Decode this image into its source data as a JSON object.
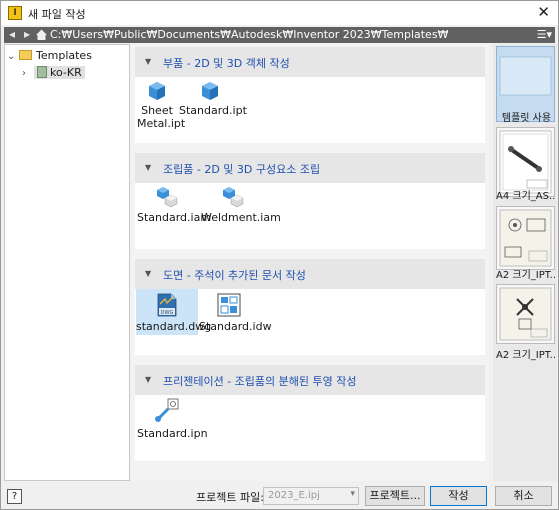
{
  "window": {
    "title": "새 파일 작성",
    "close_glyph": "✕",
    "app_icon_letter": "I"
  },
  "pathbar": {
    "back_glyph": "◂",
    "forward_glyph": "▸",
    "path": "C:₩Users₩Public₩Documents₩Autodesk₩Inventor 2023₩Templates₩",
    "view_glyph": "☰▾"
  },
  "tree": {
    "root": {
      "expand_glyph": "⌄",
      "label": "Templates"
    },
    "child": {
      "expand_glyph": "›",
      "label": "ko-KR"
    }
  },
  "sections": [
    {
      "arrow": "▼",
      "title": "부품 - 2D 및 3D 객체 작성",
      "files": [
        {
          "name": "Sheet\nMetal.ipt"
        },
        {
          "name": "Standard.ipt"
        }
      ]
    },
    {
      "arrow": "▼",
      "title": "조립품 - 2D 및 3D 구성요소 조립",
      "files": [
        {
          "name": "Standard.iam"
        },
        {
          "name": "Weldment.iam"
        }
      ]
    },
    {
      "arrow": "▼",
      "title": "도면 - 주석이 추가된 문서 작성",
      "files": [
        {
          "name": "standard.dwg",
          "badge": "DWG"
        },
        {
          "name": "Standard.idw"
        }
      ]
    },
    {
      "arrow": "▼",
      "title": "프리젠테이션 - 조립품의 분해된 투영 작성",
      "files": [
        {
          "name": "Standard.ipn"
        }
      ]
    }
  ],
  "sidebar": {
    "items": [
      {
        "label": "템플릿 사용"
      },
      {
        "label": "A4 크기_AS..."
      },
      {
        "label": "A2 크기_IPT..."
      },
      {
        "label": "A2 크기_IPT..."
      }
    ]
  },
  "footer": {
    "help_glyph": "?",
    "project_label": "프로젝트 파일:",
    "project_value": "2023_E.ipj",
    "project_dropdown_glyph": "▾",
    "projects_button": "프로젝트...",
    "create_button": "작성",
    "cancel_button": "취소"
  },
  "colors": {
    "accent": "#1f4fae",
    "selection": "#cce4f7",
    "pathbar": "#616161"
  }
}
